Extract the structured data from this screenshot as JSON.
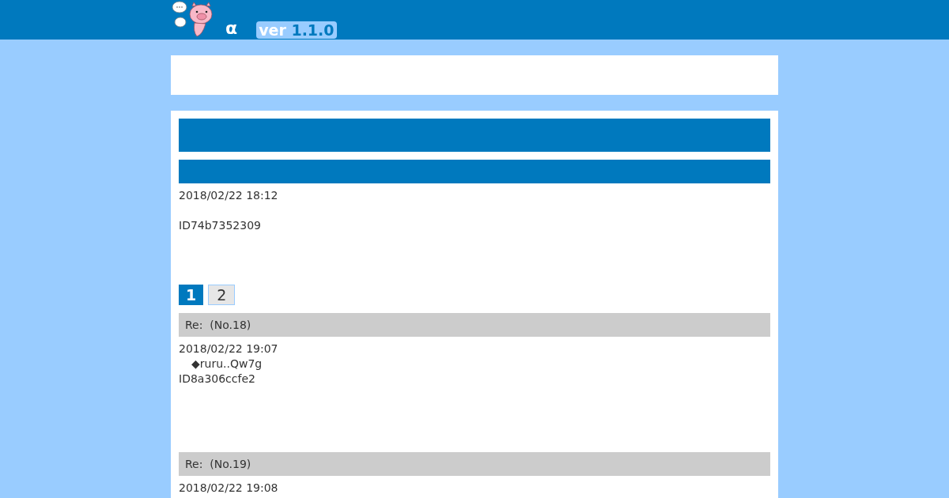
{
  "header": {
    "title": "α",
    "version_prefix": "ver",
    "version_number": "1.1.0"
  },
  "thread": {
    "posts": [
      {
        "date": "2018/02/22 18:12",
        "id": "ID74b7352309"
      }
    ],
    "pagination": [
      {
        "label": "1",
        "selected": true
      },
      {
        "label": "2",
        "selected": false
      }
    ],
    "replies": [
      {
        "title": "Re:  (No.18)",
        "date": "2018/02/22 19:07",
        "author": "◆ruru..Qw7g",
        "id": "ID8a306ccfe2"
      },
      {
        "title": "Re:  (No.19)",
        "date": "2018/02/22 19:08"
      }
    ]
  }
}
